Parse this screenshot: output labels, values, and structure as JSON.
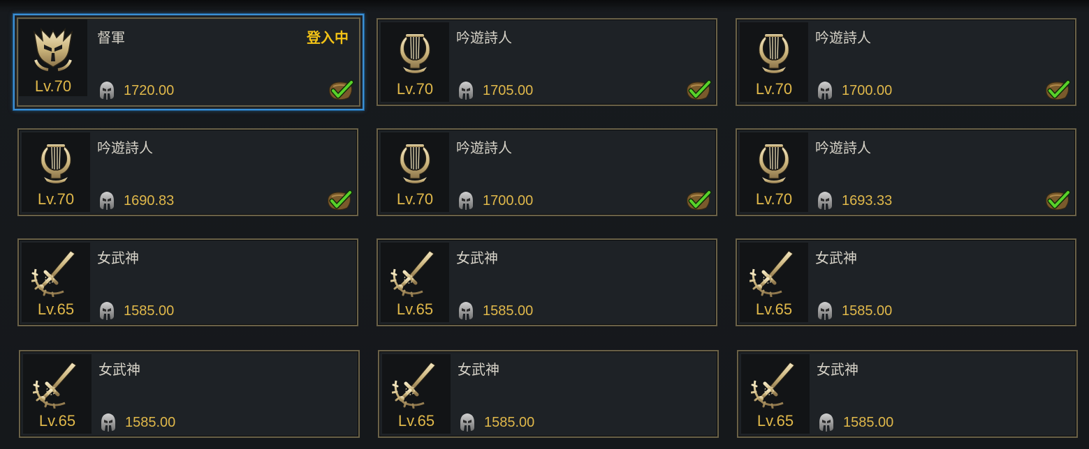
{
  "colors": {
    "frame": "#6a6147",
    "selected_frame": "#3b8fd4",
    "level_text": "#e0b84a",
    "item_level_text": "#e0b84a",
    "class_text": "#d7d3c8",
    "status_text": "#f3c316",
    "card_bg": "#1e2226"
  },
  "characters": [
    {
      "class_name": "督軍",
      "level": "Lv.70",
      "item_level": "1720.00",
      "status": "登入中",
      "emblem": "warlord-helmet-icon",
      "checked": true,
      "selected": true
    },
    {
      "class_name": "吟遊詩人",
      "level": "Lv.70",
      "item_level": "1705.00",
      "status": "",
      "emblem": "lyre-icon",
      "checked": true,
      "selected": false
    },
    {
      "class_name": "吟遊詩人",
      "level": "Lv.70",
      "item_level": "1700.00",
      "status": "",
      "emblem": "lyre-icon",
      "checked": true,
      "selected": false
    },
    {
      "class_name": "吟遊詩人",
      "level": "Lv.70",
      "item_level": "1690.83",
      "status": "",
      "emblem": "lyre-icon",
      "checked": true,
      "selected": false
    },
    {
      "class_name": "吟遊詩人",
      "level": "Lv.70",
      "item_level": "1700.00",
      "status": "",
      "emblem": "lyre-icon",
      "checked": true,
      "selected": false
    },
    {
      "class_name": "吟遊詩人",
      "level": "Lv.70",
      "item_level": "1693.33",
      "status": "",
      "emblem": "lyre-icon",
      "checked": true,
      "selected": false
    },
    {
      "class_name": "女武神",
      "level": "Lv.65",
      "item_level": "1585.00",
      "status": "",
      "emblem": "sword-laurel-icon",
      "checked": false,
      "selected": false
    },
    {
      "class_name": "女武神",
      "level": "Lv.65",
      "item_level": "1585.00",
      "status": "",
      "emblem": "sword-laurel-icon",
      "checked": false,
      "selected": false
    },
    {
      "class_name": "女武神",
      "level": "Lv.65",
      "item_level": "1585.00",
      "status": "",
      "emblem": "sword-laurel-icon",
      "checked": false,
      "selected": false
    },
    {
      "class_name": "女武神",
      "level": "Lv.65",
      "item_level": "1585.00",
      "status": "",
      "emblem": "sword-laurel-icon",
      "checked": false,
      "selected": false
    },
    {
      "class_name": "女武神",
      "level": "Lv.65",
      "item_level": "1585.00",
      "status": "",
      "emblem": "sword-laurel-icon",
      "checked": false,
      "selected": false
    },
    {
      "class_name": "女武神",
      "level": "Lv.65",
      "item_level": "1585.00",
      "status": "",
      "emblem": "sword-laurel-icon",
      "checked": false,
      "selected": false
    }
  ]
}
